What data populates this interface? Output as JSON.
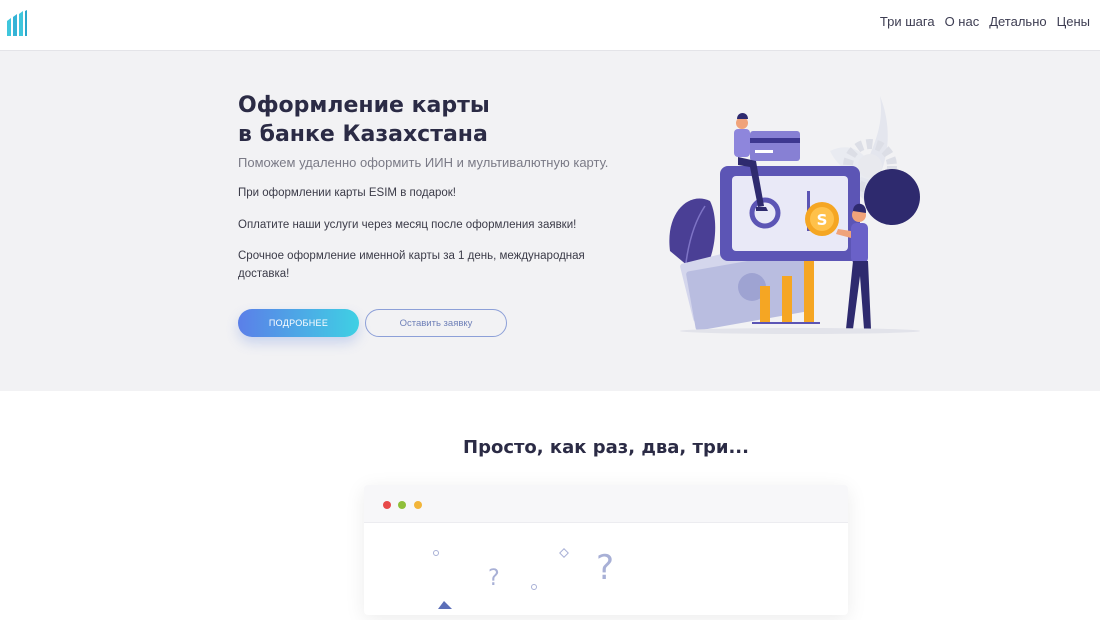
{
  "header": {
    "nav": [
      "Три шага",
      "О нас",
      "Детально",
      "Цены"
    ]
  },
  "hero": {
    "title_line1": "Оформление карты",
    "title_line2": "в банке Казахстана",
    "subtitle": "Поможем удаленно оформить ИИН и мультивалютную карту.",
    "p1": "При оформлении карты ESIM в подарок!",
    "p2": "Оплатите наши услуги через месяц после оформления заявки!",
    "p3": "Срочное оформление именной карты за 1 день, международная доставка!",
    "primary_button": "ПОДРОБНЕЕ",
    "secondary_button": "Оставить заявку"
  },
  "section2": {
    "title": "Просто, как раз, два, три..."
  },
  "colors": {
    "accent_gradient_start": "#5b7fe8",
    "accent_gradient_end": "#3fd0e4",
    "dot_red": "#e84a4a",
    "dot_green": "#8fbf3a",
    "dot_yellow": "#f2b53a"
  }
}
